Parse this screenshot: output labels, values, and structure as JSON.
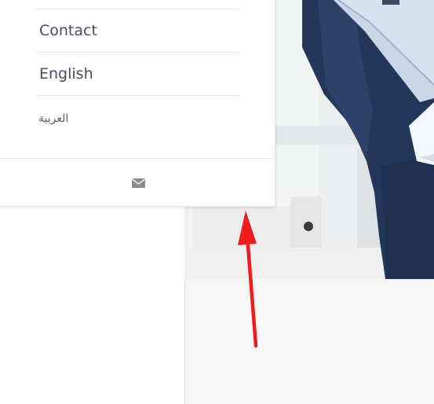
{
  "menu": {
    "items": [
      {
        "label": "Contact"
      },
      {
        "label": "English"
      },
      {
        "label": "العربية"
      }
    ],
    "footer": {
      "icon": "mail-icon"
    }
  },
  "colors": {
    "menu_text": "#4a4a63",
    "divider": "#e3e3e3",
    "annotation_arrow": "#ee1c1c",
    "suit": "#25395c",
    "lower_panel": "#f6f6f6"
  }
}
